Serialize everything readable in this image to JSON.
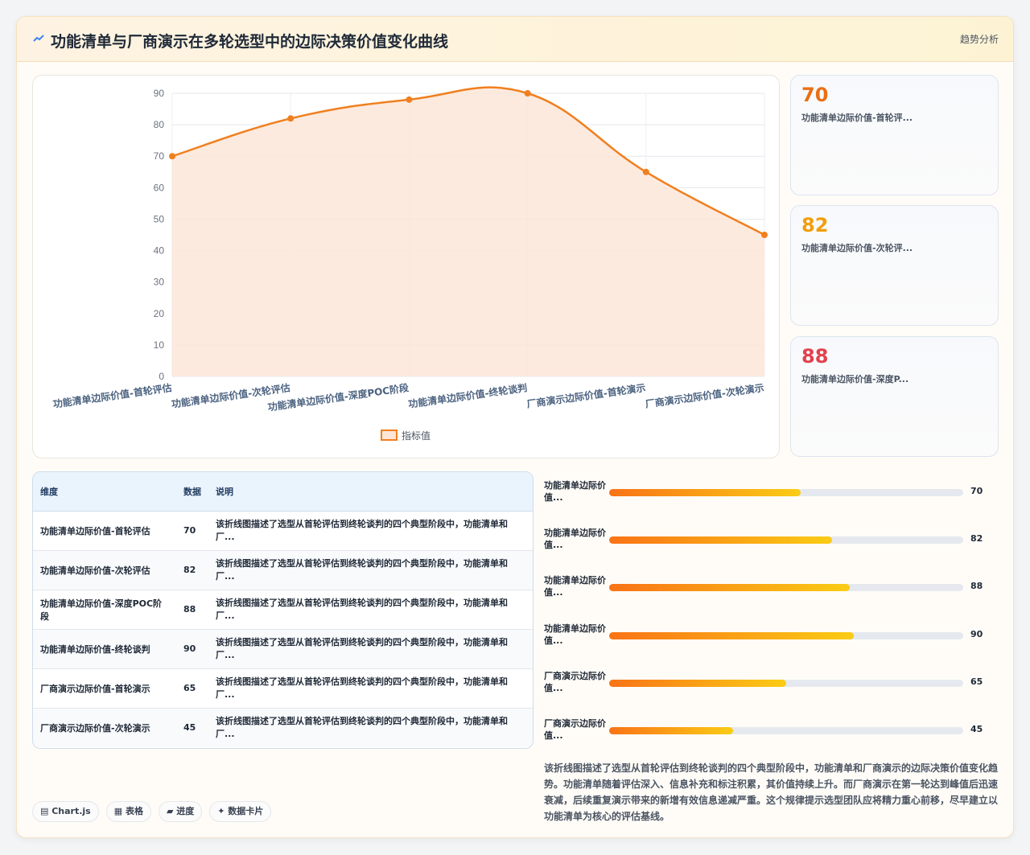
{
  "header": {
    "icon": "trend-line-icon",
    "title": "功能清单与厂商演示在多轮选型中的边际决策价值变化曲线",
    "tag": "趋势分析"
  },
  "chart_data": {
    "type": "area",
    "categories": [
      "功能清单边际价值-首轮评估",
      "功能清单边际价值-次轮评估",
      "功能清单边际价值-深度POC阶段",
      "功能清单边际价值-终轮谈判",
      "厂商演示边际价值-首轮演示",
      "厂商演示边际价值-次轮演示"
    ],
    "series": [
      {
        "name": "指标值",
        "values": [
          70,
          82,
          88,
          90,
          65,
          45
        ]
      }
    ],
    "y_ticks": [
      "0",
      "10",
      "20",
      "30",
      "40",
      "50",
      "60",
      "70",
      "80",
      "90"
    ],
    "ylim": [
      0,
      90
    ],
    "grid": true,
    "legend": "bottom",
    "colors": {
      "line": "#f07f1f",
      "fill": "#fde6d8"
    }
  },
  "stats": [
    {
      "value": "70",
      "label": "功能清单边际价值-首轮评...",
      "color": "#ea6f13"
    },
    {
      "value": "82",
      "label": "功能清单边际价值-次轮评...",
      "color": "#f29e0b"
    },
    {
      "value": "88",
      "label": "功能清单边际价值-深度P...",
      "color": "#e2424d"
    }
  ],
  "table": {
    "headers": {
      "dim": "维度",
      "val": "数据",
      "desc": "说明"
    },
    "rows": [
      {
        "dim": "功能清单边际价值-首轮评估",
        "val": "70",
        "desc": "该折线图描述了选型从首轮评估到终轮谈判的四个典型阶段中，功能清单和厂..."
      },
      {
        "dim": "功能清单边际价值-次轮评估",
        "val": "82",
        "desc": "该折线图描述了选型从首轮评估到终轮谈判的四个典型阶段中，功能清单和厂..."
      },
      {
        "dim": "功能清单边际价值-深度POC阶段",
        "val": "88",
        "desc": "该折线图描述了选型从首轮评估到终轮谈判的四个典型阶段中，功能清单和厂..."
      },
      {
        "dim": "功能清单边际价值-终轮谈判",
        "val": "90",
        "desc": "该折线图描述了选型从首轮评估到终轮谈判的四个典型阶段中，功能清单和厂..."
      },
      {
        "dim": "厂商演示边际价值-首轮演示",
        "val": "65",
        "desc": "该折线图描述了选型从首轮评估到终轮谈判的四个典型阶段中，功能清单和厂..."
      },
      {
        "dim": "厂商演示边际价值-次轮演示",
        "val": "45",
        "desc": "该折线图描述了选型从首轮评估到终轮谈判的四个典型阶段中，功能清单和厂..."
      }
    ]
  },
  "bars": [
    {
      "label": "功能清单边际价值...",
      "value": "70",
      "fraction": 0.54
    },
    {
      "label": "功能清单边际价值...",
      "value": "82",
      "fraction": 0.63
    },
    {
      "label": "功能清单边际价值...",
      "value": "88",
      "fraction": 0.68
    },
    {
      "label": "功能清单边际价值...",
      "value": "90",
      "fraction": 0.69
    },
    {
      "label": "厂商演示边际价值...",
      "value": "65",
      "fraction": 0.5
    },
    {
      "label": "厂商演示边际价值...",
      "value": "45",
      "fraction": 0.35
    }
  ],
  "summary": "该折线图描述了选型从首轮评估到终轮谈判的四个典型阶段中，功能清单和厂商演示的边际决策价值变化趋势。功能清单随着评估深入、信息补充和标注积累，其价值持续上升。而厂商演示在第一轮达到峰值后迅速衰减，后续重复演示带来的新增有效信息递减严重。这个规律提示选型团队应将精力重心前移，尽早建立以功能清单为核心的评估基线。",
  "chips": [
    "▤ Chart.js",
    "▦ 表格",
    "▰ 进度",
    "✦ 数据卡片"
  ]
}
